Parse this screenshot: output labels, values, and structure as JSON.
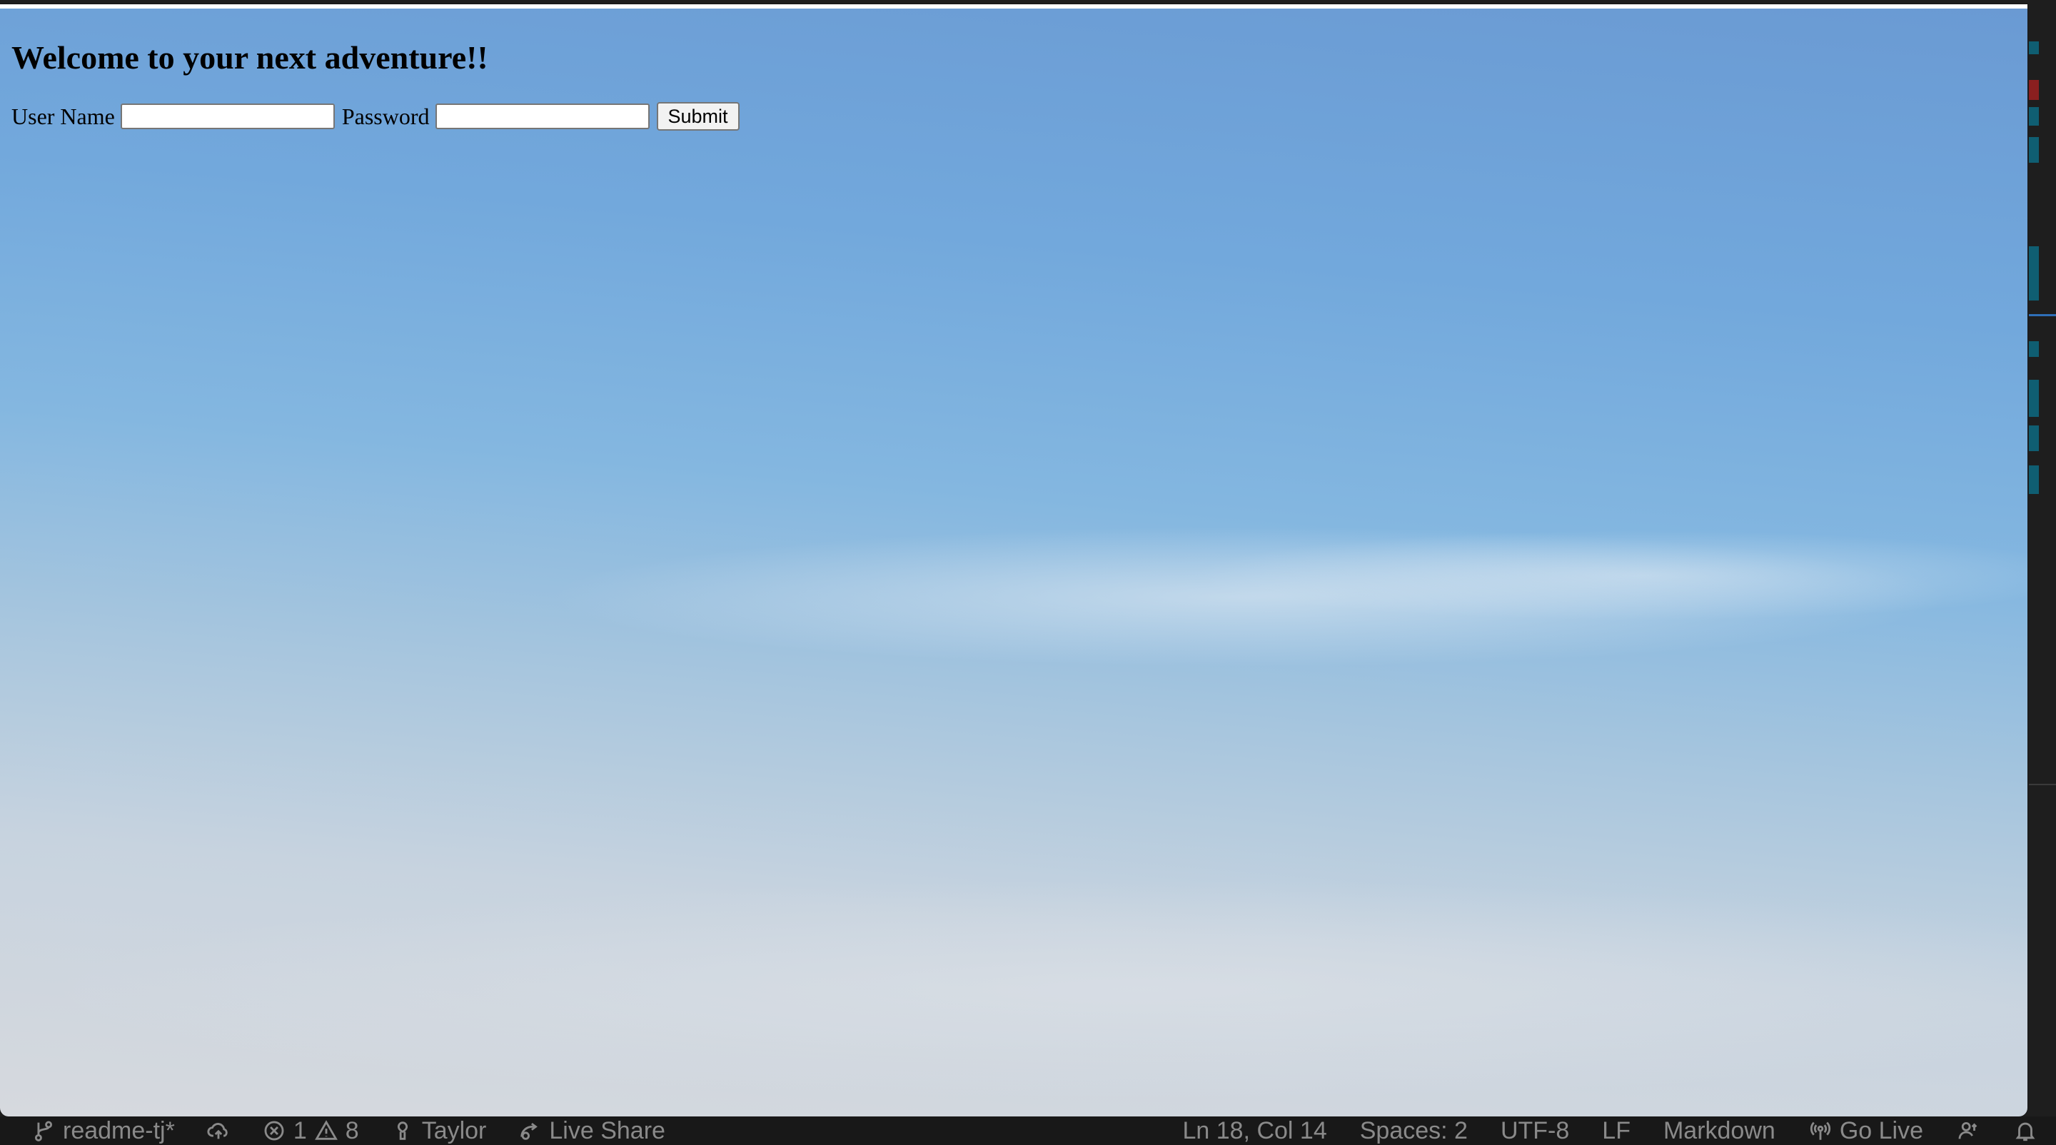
{
  "page": {
    "heading": "Welcome to your next adventure!!",
    "form": {
      "username_label": "User Name",
      "username_value": "",
      "password_label": "Password",
      "password_value": "",
      "submit_label": "Submit"
    }
  },
  "status_bar": {
    "branch": "readme-tj*",
    "errors": "1",
    "warnings": "8",
    "user": "Taylor",
    "live_share": "Live Share",
    "cursor_position": "Ln 18, Col 14",
    "spaces": "Spaces: 2",
    "encoding": "UTF-8",
    "line_ending": "LF",
    "language": "Markdown",
    "go_live": "Go Live"
  },
  "colors": {
    "status_bar_bg": "#181818",
    "status_bar_text": "#8a8a8a",
    "editor_bg": "#1e1e1e"
  },
  "icons": {
    "branch": "git-branch-icon",
    "sync": "cloud-upload-icon",
    "errors": "error-circle-icon",
    "warnings": "warning-triangle-icon",
    "user": "person-pin-icon",
    "live_share": "live-share-icon",
    "go_live": "broadcast-icon",
    "accounts": "accounts-icon",
    "notifications": "bell-icon"
  }
}
